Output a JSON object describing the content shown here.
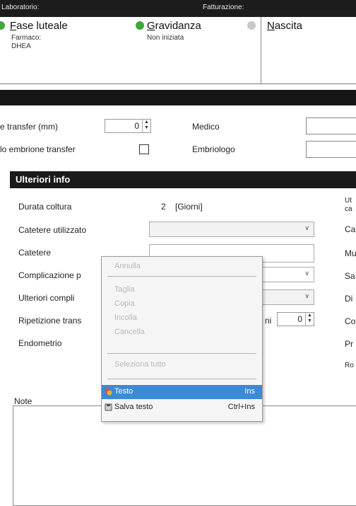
{
  "header": {
    "left_label": "Laboratorio:",
    "right_label": "Fatturazione:"
  },
  "phases": [
    {
      "title_pre": "",
      "title_ul": "F",
      "title_rest": "ase luteale",
      "sub1": "Farmaco:",
      "sub2": "DHEA",
      "dot_color": "#3da83d"
    },
    {
      "title_pre": "",
      "title_ul": "G",
      "title_rest": "ravidanza",
      "sub1": "Non iniziata",
      "sub2": "",
      "dot_color": "#3da83d"
    },
    {
      "title_pre": "",
      "title_ul": "N",
      "title_rest": "ascita",
      "sub1": "",
      "sub2": "",
      "dot_color": "#c8c8c8"
    }
  ],
  "transfer": {
    "transfer_label": "e transfer (mm)",
    "transfer_value": "0",
    "embryo_label": "lo embrione transfer",
    "doctor_label": "Medico",
    "embryologist_label": "Embriologo"
  },
  "further_info": {
    "title": "Ulteriori info",
    "culture_label": "Durata coltura",
    "culture_value": "2",
    "culture_unit": "[Giorni]",
    "catheter_type_label": "Catetere utilizzato",
    "catheter_label": "Catetere",
    "complications_label": "Complicazione p",
    "other_complications_label": "Ulteriori compli",
    "repeat_label": "Ripetizione trans",
    "repeat_value": "0",
    "repeat_side_text": "ni",
    "endometrium_label": "Endometrio",
    "notes_label": "Note",
    "right_col": [
      "Ut",
      "ca",
      "Ca",
      "Mu",
      "Sa",
      "Di",
      "Co",
      "Pr",
      "Ro"
    ]
  },
  "context_menu": {
    "items": [
      {
        "label": "Annulla",
        "shortcut": "",
        "state": "disabled"
      },
      {
        "label": "Taglia",
        "shortcut": "",
        "state": "disabled"
      },
      {
        "label": "Copia",
        "shortcut": "",
        "state": "disabled"
      },
      {
        "label": "Incolla",
        "shortcut": "",
        "state": "disabled"
      },
      {
        "label": "Cancella",
        "shortcut": "",
        "state": "disabled"
      },
      {
        "label": "Seleziona tutto",
        "shortcut": "",
        "state": "disabled"
      },
      {
        "label": "Testo",
        "shortcut": "Ins",
        "state": "highlighted"
      },
      {
        "label": "Salva testo",
        "shortcut": "Ctrl+Ins",
        "state": "enabled"
      }
    ]
  },
  "colors": {
    "highlight": "#3c8ad6",
    "dark_band": "#161616",
    "status_green": "#3da83d"
  }
}
